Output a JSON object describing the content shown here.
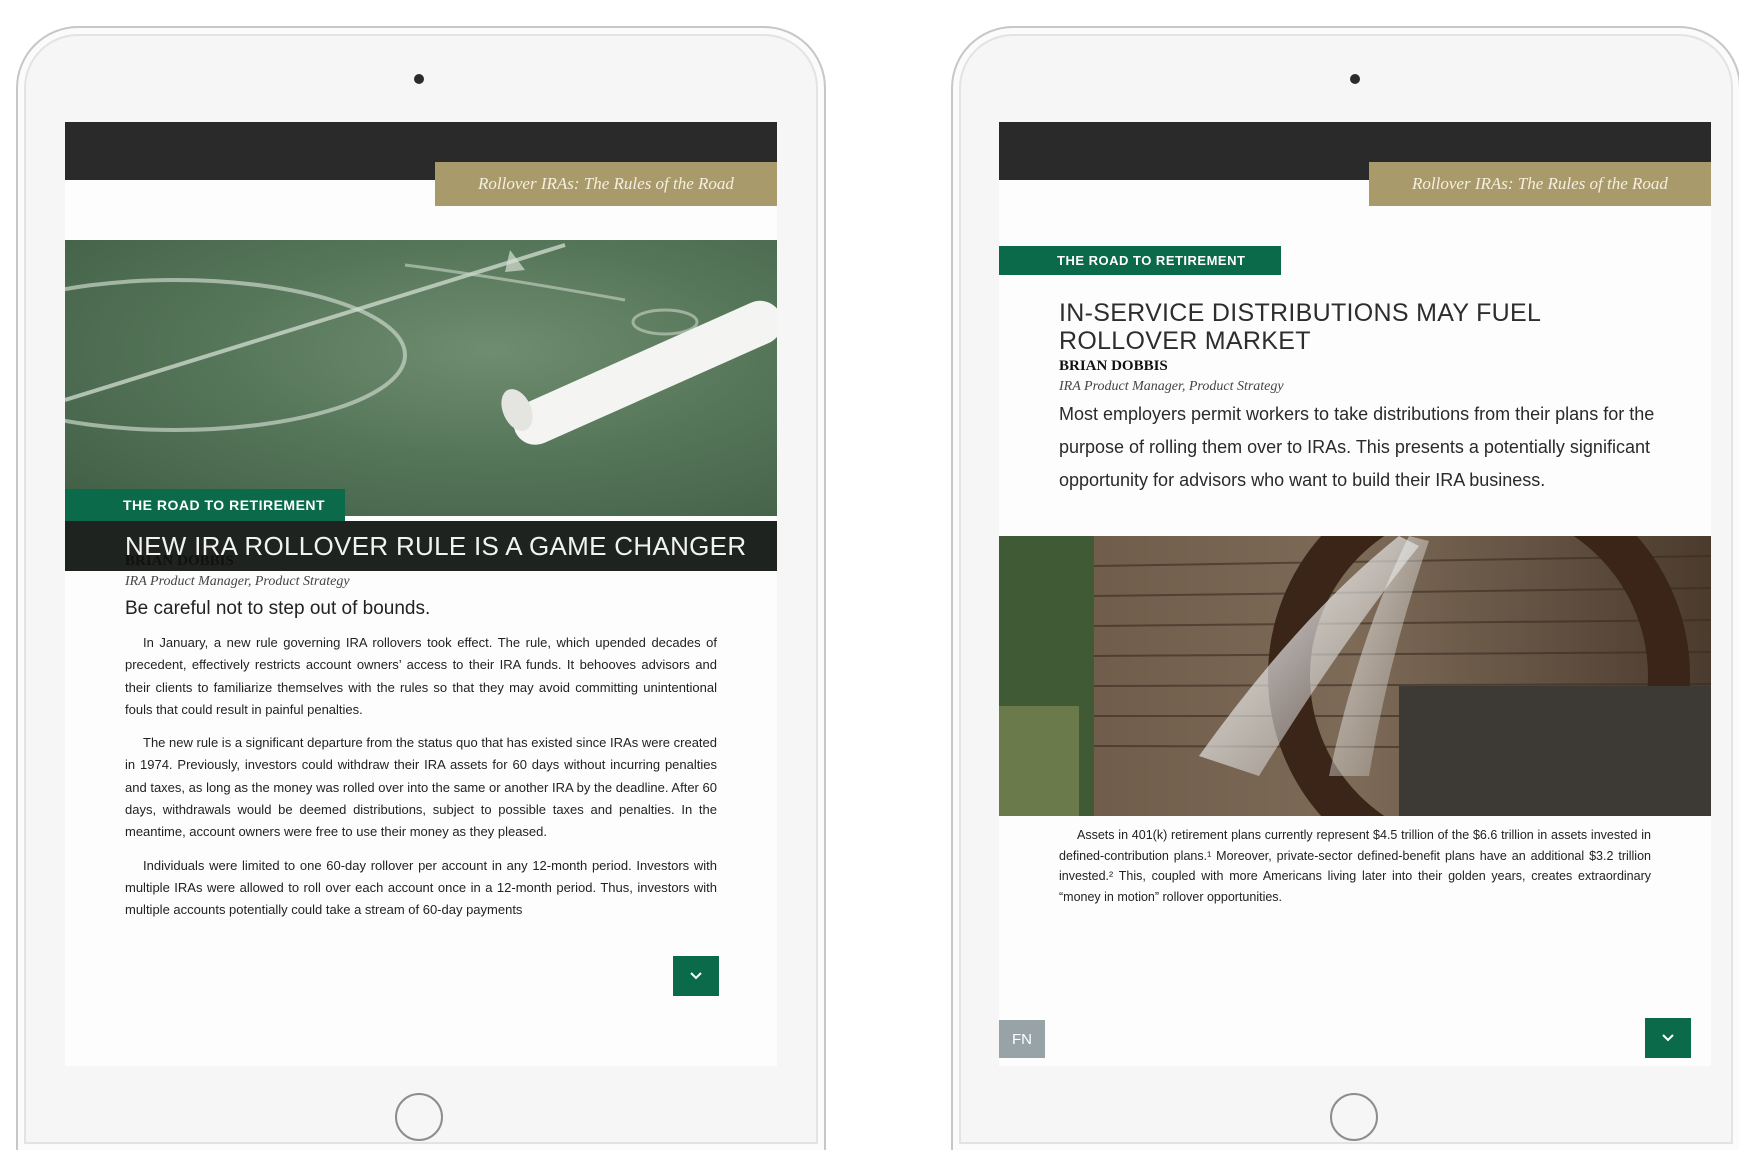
{
  "left_page": {
    "running_head": "Rollover IRAs: The Rules of the Road",
    "section_tag": "THE ROAD TO RETIREMENT",
    "title": "NEW IRA ROLLOVER RULE IS A GAME CHANGER",
    "author": "BRIAN DOBBIS",
    "role": "IRA Product Manager, Product Strategy",
    "deck": "Be careful not to step out of bounds.",
    "paragraphs": [
      "In January, a new rule governing IRA rollovers took effect. The rule, which upended decades of precedent, effectively restricts account owners’ access to their IRA funds. It behooves advisors and their clients to familiarize themselves with the rules so that they may avoid committing unintentional fouls that could result in painful penalties.",
      "The new rule is a significant departure from the status quo that has existed since IRAs were created in 1974. Previously, investors could withdraw their IRA assets for 60 days without incurring penalties and taxes, as long as the money was rolled over into the same or another IRA by the deadline. After 60 days, withdrawals would be deemed distributions, subject to possible taxes and penalties. In the meantime, account owners were free to use their money as they pleased.",
      "Individuals were limited to one 60-day rollover per account in any 12-month period. Investors with multiple IRAs were allowed to roll over each account once in a 12-month period. Thus, investors with multiple accounts potentially could take a stream of 60-day payments"
    ],
    "next_icon": "chevron-down-icon"
  },
  "right_page": {
    "running_head": "Rollover IRAs: The Rules of the Road",
    "section_tag": "THE ROAD TO RETIREMENT",
    "title": "IN-SERVICE DISTRIBUTIONS MAY FUEL ROLLOVER MARKET",
    "author": "BRIAN DOBBIS",
    "role": "IRA Product Manager, Product Strategy",
    "deck": "Most employers permit workers to take distributions from their plans for the purpose of rolling them over to IRAs. This presents a potentially significant opportunity for advisors who want to build their IRA business.",
    "paragraphs": [
      "Assets in 401(k) retirement plans currently represent $4.5 trillion of the $6.6 trillion in assets invested in defined-contribution plans.¹ Moreover, private-sector defined-benefit plans have an additional $3.2 trillion invested.² This, coupled with more Americans living later into their golden years, creates extraordinary “money in motion” rollover opportunities."
    ],
    "fn_label": "FN",
    "next_icon": "chevron-down-icon"
  },
  "colors": {
    "accent_green": "#0b6a4a",
    "gold": "#a99a6b",
    "dark_band": "#2a2a2a"
  }
}
